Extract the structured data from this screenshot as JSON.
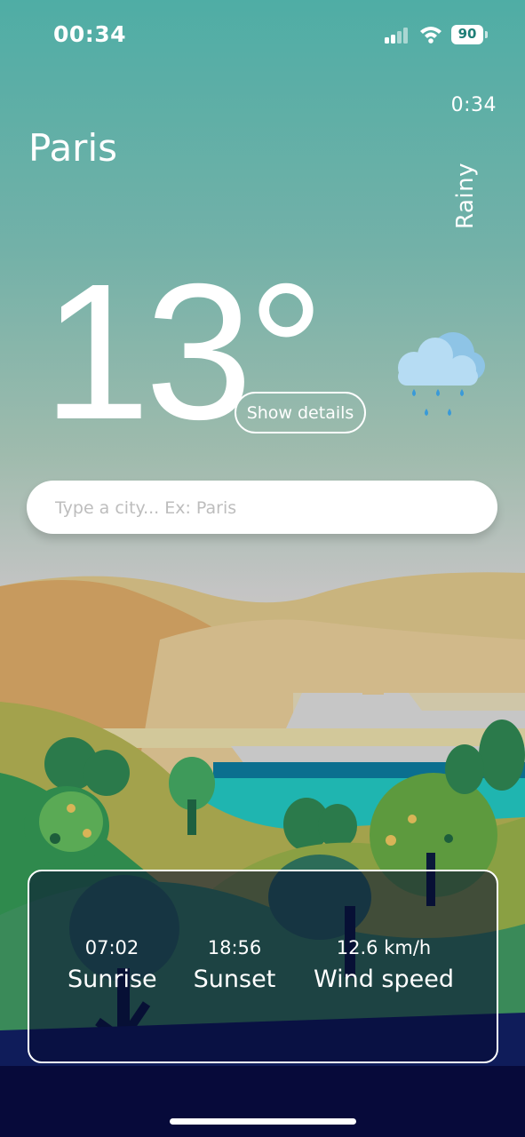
{
  "status_bar": {
    "time": "00:34",
    "battery": "90"
  },
  "weather": {
    "local_time": "0:34",
    "city": "Paris",
    "condition": "Rainy",
    "temperature": "13°",
    "details_button": "Show details",
    "icon": "rain-cloud-icon"
  },
  "search": {
    "placeholder": "Type a city... Ex: Paris",
    "value": ""
  },
  "info": {
    "sunrise": {
      "value": "07:02",
      "label": "Sunrise"
    },
    "sunset": {
      "value": "18:56",
      "label": "Sunset"
    },
    "wind": {
      "value": "12.6 km/h",
      "label": "Wind speed"
    }
  },
  "colors": {
    "sky_top": "#4fada5",
    "card_bg": "#0a0f3c",
    "accent": "#b6dcf3"
  }
}
